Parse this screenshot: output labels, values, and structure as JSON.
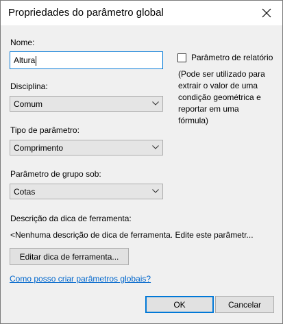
{
  "window": {
    "title": "Propriedades do parâmetro global"
  },
  "name_field": {
    "label": "Nome:",
    "value": "Altura"
  },
  "reporting": {
    "checkbox_label": "Parâmetro de relatório",
    "checked": false,
    "note_lines": [
      "(Pode ser utilizado para",
      "extrair o valor de uma",
      "condição geométrica e",
      "reportar em uma",
      "fórmula)"
    ]
  },
  "discipline": {
    "label": "Disciplina:",
    "selected": "Comum"
  },
  "parameter_type": {
    "label": "Tipo de parâmetro:",
    "selected": "Comprimento"
  },
  "group": {
    "label": "Parâmetro de grupo sob:",
    "selected": "Cotas"
  },
  "tooltip": {
    "label": "Descrição da dica de ferramenta:",
    "description": "<Nenhuma descrição de dica de ferramenta. Edite este parâmetr...",
    "edit_button": "Editar dica de ferramenta..."
  },
  "help_link": "Como posso criar parâmetros globais?",
  "buttons": {
    "ok": "OK",
    "cancel": "Cancelar"
  },
  "colors": {
    "accent": "#0078d7",
    "link": "#0066cc",
    "dialog_bg": "#f0f0f0"
  }
}
